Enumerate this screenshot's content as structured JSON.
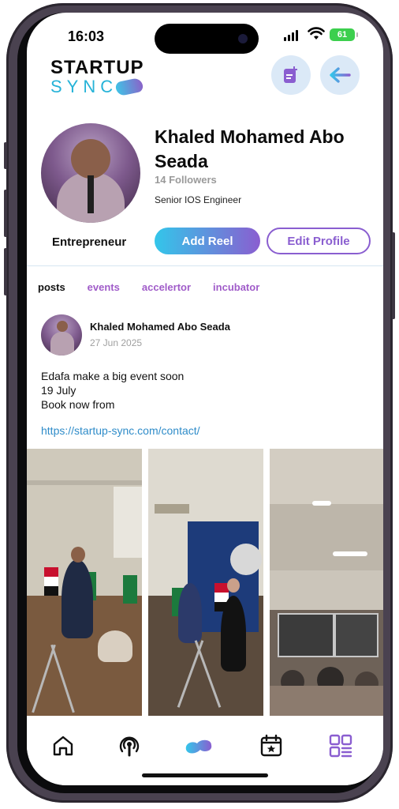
{
  "status_bar": {
    "time": "16:03",
    "battery": "61"
  },
  "header": {
    "logo_top": "STARTUP",
    "logo_bottom": "SYNC"
  },
  "profile": {
    "name": "Khaled Mohamed Abo Seada",
    "followers": "14 Followers",
    "job_title": "Senior IOS Engineer",
    "role": "Entrepreneur",
    "add_reel_label": "Add Reel",
    "edit_profile_label": "Edit Profile"
  },
  "tabs": [
    {
      "label": "posts",
      "active": true
    },
    {
      "label": "events",
      "active": false
    },
    {
      "label": "accelertor",
      "active": false
    },
    {
      "label": "incubator",
      "active": false
    }
  ],
  "post": {
    "author": "Khaled Mohamed Abo Seada",
    "date": "27 Jun 2025",
    "lines": [
      "Edafa make a big event soon",
      "19 July",
      "Book now from"
    ],
    "link": "https://startup-sync.com/contact/"
  },
  "nav": [
    "home-icon",
    "podcast-icon",
    "logo-icon",
    "calendar-icon",
    "grid-menu-icon"
  ],
  "colors": {
    "accent_purple": "#8a5ed0",
    "accent_cyan": "#33c6ea",
    "tab_purple": "#a05cc9",
    "link_blue": "#2f8cc9"
  }
}
